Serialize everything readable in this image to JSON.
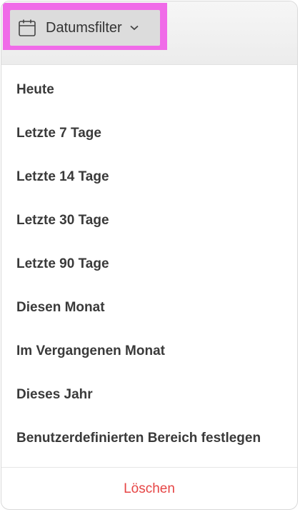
{
  "date_filter": {
    "trigger_label": "Datumsfilter",
    "trigger_icon": "calendar-icon",
    "chevron_icon": "chevron-down-icon",
    "highlight_color": "#f06be8",
    "options": [
      "Heute",
      "Letzte 7 Tage",
      "Letzte 14 Tage",
      "Letzte 30 Tage",
      "Letzte 90 Tage",
      "Diesen Monat",
      "Im Vergangenen Monat",
      "Dieses Jahr",
      "Benutzerdefinierten Bereich festlegen"
    ],
    "clear_label": "Löschen",
    "clear_color": "#e64545"
  }
}
